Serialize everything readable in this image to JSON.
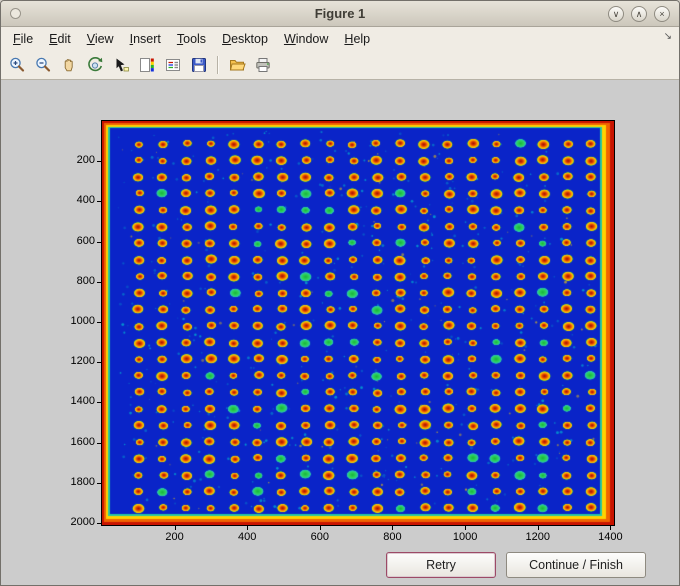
{
  "window": {
    "title": "Figure 1",
    "controls": {
      "shade": "∨",
      "unshade": "∧",
      "close": "×"
    }
  },
  "menu": {
    "items": [
      {
        "label": "File"
      },
      {
        "label": "Edit"
      },
      {
        "label": "View"
      },
      {
        "label": "Insert"
      },
      {
        "label": "Tools"
      },
      {
        "label": "Desktop"
      },
      {
        "label": "Window"
      },
      {
        "label": "Help"
      }
    ],
    "overflow_icon": "↘"
  },
  "toolbar": {
    "buttons": [
      "zoom-in",
      "zoom-out",
      "pan",
      "rotate-3d",
      "data-cursor",
      "insert-colorbar",
      "insert-legend",
      "save-figure",
      "open-file",
      "print-figure"
    ]
  },
  "figure": {
    "buttons": {
      "retry": "Retry",
      "continue_finish": "Continue / Finish"
    },
    "plate": {
      "description": "Scanned microarray plate image, jet colormap: blue field, grid of red/orange spots, red-orange glowing edges",
      "x_max": 1410,
      "y_max": 2010,
      "x_ticks": [
        200,
        400,
        600,
        800,
        1000,
        1200,
        1400
      ],
      "y_ticks": [
        200,
        400,
        600,
        800,
        1000,
        1200,
        1400,
        1600,
        1800,
        2000
      ],
      "background": "#0a24c8",
      "edge_bands": [
        {
          "color": "#c81400",
          "inset": [
            0,
            0,
            0,
            0
          ]
        },
        {
          "color": "#f06400",
          "inset": [
            2,
            2,
            4,
            3
          ]
        },
        {
          "color": "#ffd200",
          "inset": [
            4,
            4,
            8,
            6
          ]
        },
        {
          "color": "#28c8a0",
          "inset": [
            6,
            6,
            12,
            9
          ]
        },
        {
          "color": "#0a24c8",
          "inset": [
            8,
            7,
            14,
            11
          ]
        }
      ],
      "grid": {
        "rows": 23,
        "cols": 20,
        "x0": 37,
        "y0": 23,
        "dx": 23.8,
        "dy": 16.55,
        "rx": 5.4,
        "ry": 4.3
      },
      "green_dot_ratio": 0.13,
      "speck_count": 520,
      "speck_color": "#00c8d2"
    }
  }
}
